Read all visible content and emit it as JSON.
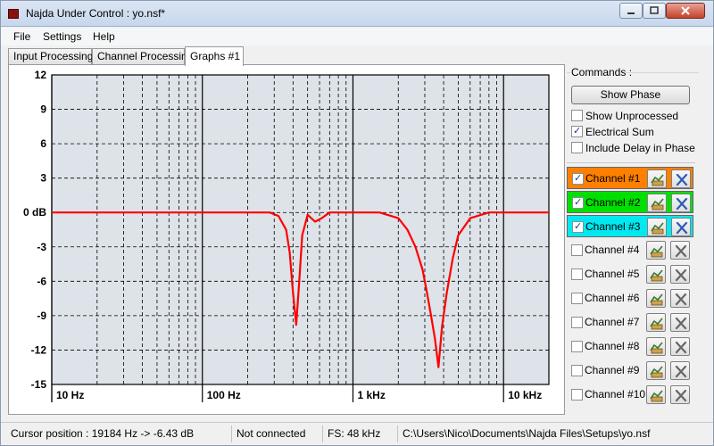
{
  "window": {
    "title": "Najda Under Control : yo.nsf*"
  },
  "menu": [
    "File",
    "Settings",
    "Help"
  ],
  "tabs": [
    "Input Processing",
    "Channel Processing",
    "Graphs #1"
  ],
  "graph": {
    "y_ticks": [
      "12",
      "9",
      "6",
      "3",
      "0 dB",
      "-3",
      "-6",
      "-9",
      "-12",
      "-15"
    ],
    "x_ticks": [
      "10 Hz",
      "100 Hz",
      "1 kHz",
      "10 kHz"
    ],
    "curve_color": "#ff0000",
    "background": "#dde3e8"
  },
  "chart_data": {
    "type": "line",
    "x_scale": "log",
    "xlim": [
      10,
      20000
    ],
    "ylim": [
      -15,
      12
    ],
    "y_ticks": [
      12,
      9,
      6,
      3,
      0,
      -3,
      -6,
      -9,
      -12,
      -15
    ],
    "x_ticks": [
      10,
      100,
      1000,
      10000
    ],
    "grid": true,
    "series": [
      {
        "color": "#ff0000",
        "x": [
          10,
          100,
          200,
          280,
          320,
          360,
          380,
          400,
          420,
          440,
          460,
          500,
          560,
          620,
          700,
          1000,
          1500,
          2000,
          2300,
          2600,
          2900,
          3100,
          3300,
          3500,
          3700,
          3900,
          4200,
          4600,
          5000,
          6000,
          8000,
          10000,
          20000
        ],
        "y": [
          0,
          0,
          0,
          0,
          -0.3,
          -1.5,
          -3.5,
          -7,
          -9.8,
          -6,
          -2,
          -0.2,
          -0.8,
          -0.5,
          0,
          0,
          0,
          -0.5,
          -1.5,
          -3,
          -5,
          -7,
          -9,
          -11,
          -13.5,
          -10,
          -7,
          -4,
          -2,
          -0.5,
          0,
          0,
          0
        ]
      }
    ]
  },
  "commands": {
    "title": "Commands :",
    "show_phase": "Show Phase",
    "options": [
      {
        "label": "Show Unprocessed",
        "checked": false
      },
      {
        "label": "Electrical Sum",
        "checked": true
      },
      {
        "label": "Include Delay in Phase",
        "checked": false
      }
    ]
  },
  "channels": [
    {
      "label": "Channel #1",
      "checked": true,
      "color": "#ff8000"
    },
    {
      "label": "Channel #2",
      "checked": true,
      "color": "#00e000"
    },
    {
      "label": "Channel #3",
      "checked": true,
      "color": "#00e8f0"
    },
    {
      "label": "Channel #4",
      "checked": false,
      "color": ""
    },
    {
      "label": "Channel #5",
      "checked": false,
      "color": ""
    },
    {
      "label": "Channel #6",
      "checked": false,
      "color": ""
    },
    {
      "label": "Channel #7",
      "checked": false,
      "color": ""
    },
    {
      "label": "Channel #8",
      "checked": false,
      "color": ""
    },
    {
      "label": "Channel #9",
      "checked": false,
      "color": ""
    },
    {
      "label": "Channel #10",
      "checked": false,
      "color": ""
    }
  ],
  "status": {
    "cursor": "Cursor position : 19184 Hz -> -6.43 dB",
    "connection": "Not connected",
    "fs": "FS: 48 kHz",
    "path": "C:\\Users\\Nico\\Documents\\Najda Files\\Setups\\yo.nsf"
  }
}
